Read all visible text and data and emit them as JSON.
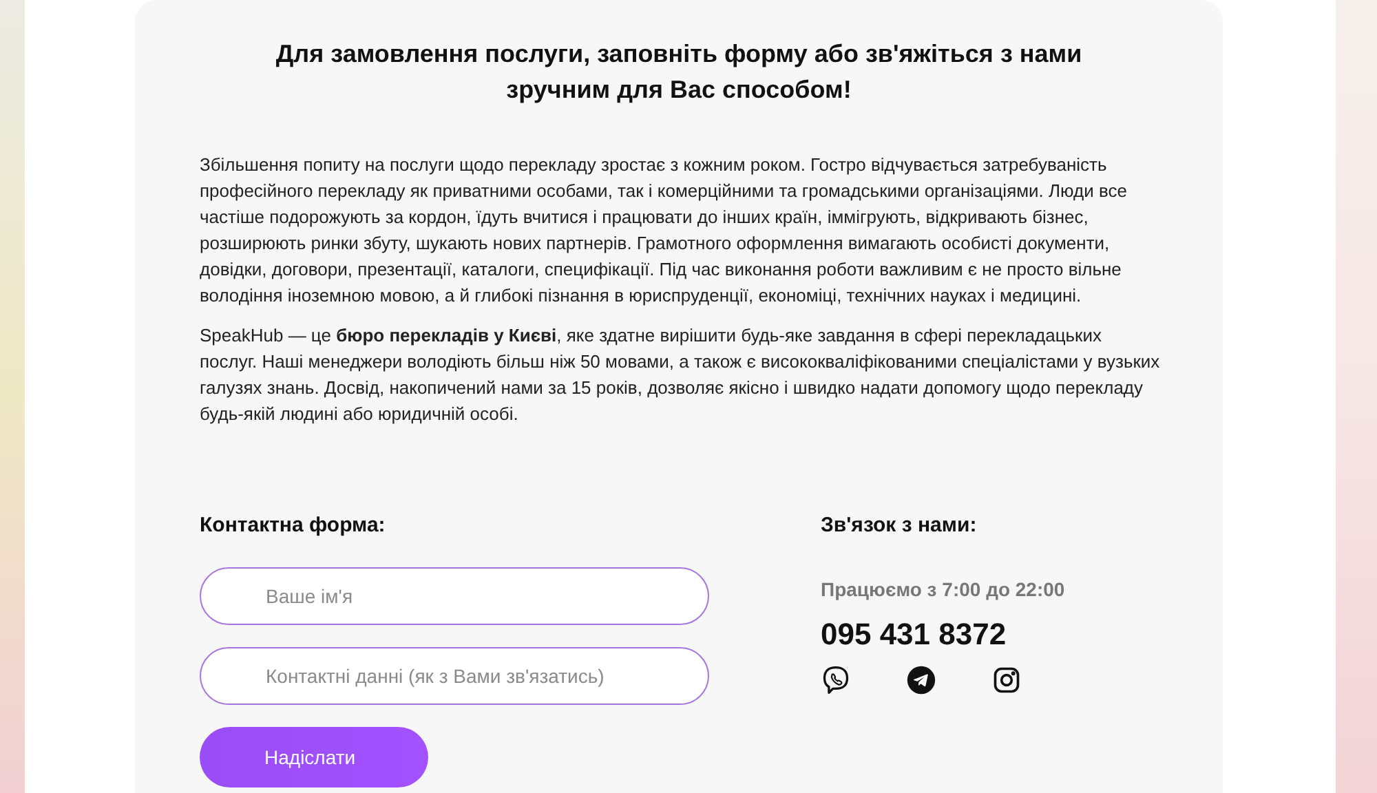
{
  "heading": "Для замовлення послуги, заповніть форму або зв'яжіться з нами зручним для Вас способом!",
  "paragraphs": [
    "Збільшення попиту на послуги щодо перекладу зростає з кожним роком. Гостро відчувається затребуваність професійного перекладу як приватними особами, так і комерційними та громадськими організаціями. Люди все частіше подорожують за кордон, їдуть вчитися і працювати до інших країн, іммігрують, відкривають бізнес, розширюють ринки збуту, шукають нових партнерів. Грамотного оформлення вимагають особисті документи, довідки, договори, презентації, каталоги, специфікації. Під час виконання роботи важливим є не просто вільне володіння іноземною мовою, а й глибокі пізнання в юриспруденції, економіці, технічних науках і медицині.",
    "SpeakHub — це **бюро перекладів у Києві**, яке здатне вирішити будь-яке завдання в сфері перекладацьких послуг. Наші менеджери володіють більш ніж 50 мовами, а також є висококваліфікованими спеціалістами у вузьких галузях знань. Досвід, накопичений нами за 15 років, дозволяє якісно і швидко надати допомогу щодо перекладу будь-якій людині або юридичній особі."
  ],
  "contact_form": {
    "title": "Контактна форма:",
    "fields": [
      {
        "placeholder": "Ваше ім'я"
      },
      {
        "placeholder": "Контактні данні (як з Вами зв'язатись)"
      }
    ],
    "submit": "Надіслати"
  },
  "contacts": {
    "title": "Зв'язок з нами:",
    "hours": "Працюємо з 7:00 до 22:00",
    "phone": "095 431 8372",
    "socials": [
      {
        "kind": "viber"
      },
      {
        "kind": "telegram"
      },
      {
        "kind": "instagram"
      }
    ]
  }
}
